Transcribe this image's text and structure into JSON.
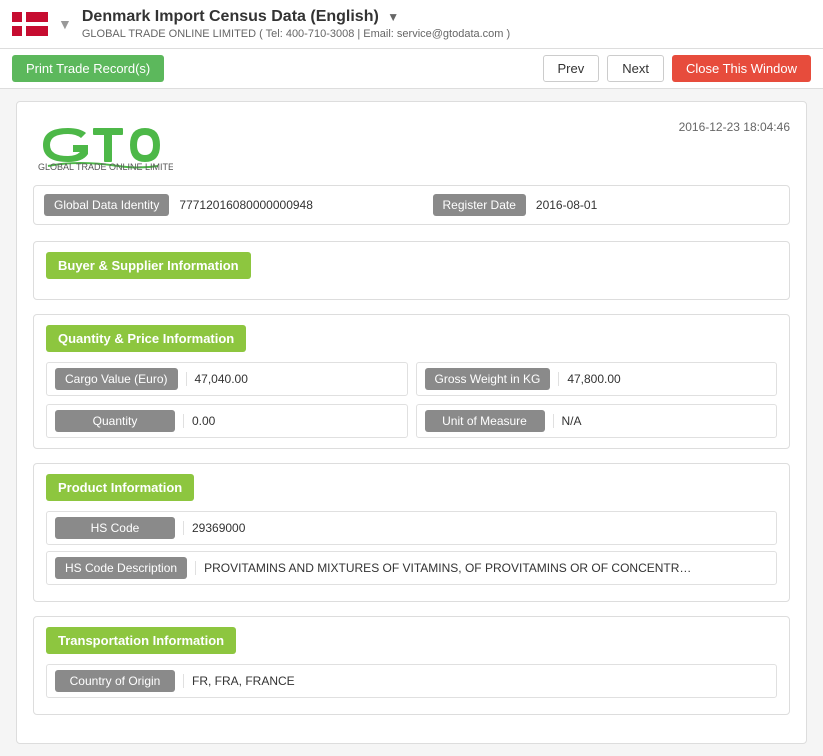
{
  "header": {
    "title": "Denmark Import Census Data (English)",
    "subtitle": "GLOBAL TRADE ONLINE LIMITED ( Tel: 400-710-3008 | Email: service@gtodata.com )",
    "logo_company": "GLOBAL TRADE ONLINE LIMITED"
  },
  "toolbar": {
    "print_label": "Print Trade Record(s)",
    "prev_label": "Prev",
    "next_label": "Next",
    "close_label": "Close This Window"
  },
  "record": {
    "timestamp": "2016-12-23 18:04:46",
    "global_data_identity_label": "Global Data Identity",
    "global_data_identity_value": "77712016080000000948",
    "register_date_label": "Register Date",
    "register_date_value": "2016-08-01",
    "sections": {
      "buyer_supplier": {
        "title": "Buyer & Supplier Information",
        "fields": []
      },
      "quantity_price": {
        "title": "Quantity & Price Information",
        "fields": [
          {
            "label": "Cargo Value (Euro)",
            "value": "47,040.00",
            "col": 1
          },
          {
            "label": "Gross Weight in KG",
            "value": "47,800.00",
            "col": 2
          },
          {
            "label": "Quantity",
            "value": "0.00",
            "col": 1
          },
          {
            "label": "Unit of Measure",
            "value": "N/A",
            "col": 2
          }
        ]
      },
      "product": {
        "title": "Product Information",
        "fields": [
          {
            "label": "HS Code",
            "value": "29369000"
          },
          {
            "label": "HS Code Description",
            "value": "PROVITAMINS AND MIXTURES OF VITAMINS, OF PROVITAMINS OR OF CONCENTRATES, WH"
          }
        ]
      },
      "transportation": {
        "title": "Transportation Information",
        "fields": [
          {
            "label": "Country of Origin",
            "value": "FR, FRA, FRANCE"
          }
        ]
      }
    }
  }
}
